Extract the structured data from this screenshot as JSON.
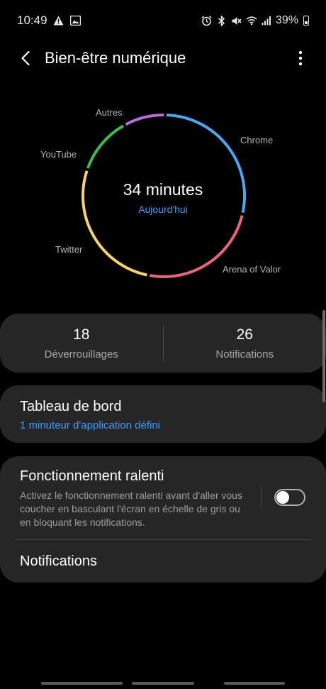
{
  "status_bar": {
    "time": "10:49",
    "battery_percent": "39%",
    "icons": [
      "warning-icon",
      "image-icon",
      "alarm-icon",
      "bluetooth-icon",
      "mute-icon",
      "wifi-icon",
      "signal-icon",
      "battery-icon"
    ]
  },
  "app_bar": {
    "title": "Bien-être numérique"
  },
  "usage": {
    "total": "34 minutes",
    "period": "Aujourd'hui",
    "apps": [
      {
        "name": "Chrome",
        "color": "#4aa8f0"
      },
      {
        "name": "Arena of Valor",
        "color": "#e8647a"
      },
      {
        "name": "Twitter",
        "color": "#f5d36a"
      },
      {
        "name": "YouTube",
        "color": "#3dba4e"
      },
      {
        "name": "Autres",
        "color": "#b86fd4"
      }
    ]
  },
  "stats": {
    "unlocks_value": "18",
    "unlocks_label": "Déverrouillages",
    "notifications_value": "26",
    "notifications_label": "Notifications"
  },
  "dashboard": {
    "title": "Tableau de bord",
    "subtitle": "1 minuteur d'application défini"
  },
  "wind_down": {
    "title": "Fonctionnement ralenti",
    "description": "Activez le fonctionnement ralenti avant d'aller vous coucher en basculant l'écran en échelle de gris ou en bloquant les notifications.",
    "enabled": false
  },
  "notifications_row": {
    "title": "Notifications"
  },
  "colors": {
    "accent": "#3e9bff",
    "card_bg": "#262626",
    "background": "#000000"
  }
}
